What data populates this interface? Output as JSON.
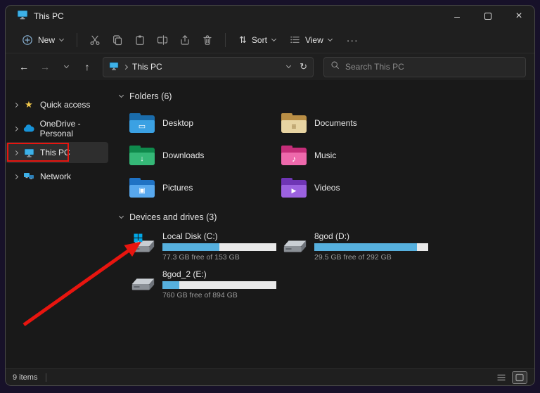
{
  "colors": {
    "annotation_red": "#e8150f",
    "drive_bar_fill": "#56b0de",
    "folder_accent_blue": "#3ba1e3"
  },
  "icons": {
    "app": "this-pc-monitor",
    "new": "circled-plus",
    "cut": "scissors",
    "copy": "two-pages",
    "paste": "clipboard",
    "rename": "text-cursor-box",
    "share": "box-up-arrow",
    "delete": "trash-can",
    "sort": "up-down-arrows",
    "view": "list-lines",
    "more": "ellipsis",
    "back": "left-arrow",
    "forward": "right-arrow",
    "recent-locations": "chevron-down",
    "up": "up-arrow",
    "refresh": "circular-arrow",
    "search": "magnifier",
    "details-view": "list-lines",
    "thumbnail-view": "square-outline"
  },
  "window": {
    "title": "This PC"
  },
  "toolbar": {
    "new_label": "New",
    "sort_label": "Sort",
    "view_label": "View",
    "more_label": "···"
  },
  "navbar": {
    "breadcrumb": "This PC",
    "search_placeholder": "Search This PC"
  },
  "sidebar": {
    "items": [
      {
        "label": "Quick access"
      },
      {
        "label": "OneDrive - Personal"
      },
      {
        "label": "This PC"
      },
      {
        "label": "Network"
      }
    ]
  },
  "main": {
    "folders_section": {
      "title": "Folders (6)"
    },
    "folders": [
      {
        "name": "Desktop"
      },
      {
        "name": "Documents"
      },
      {
        "name": "Downloads"
      },
      {
        "name": "Music"
      },
      {
        "name": "Pictures"
      },
      {
        "name": "Videos"
      }
    ],
    "drives_section": {
      "title": "Devices and drives (3)"
    },
    "drives": [
      {
        "name": "Local Disk (C:)",
        "free_text": "77.3 GB free of 153 GB",
        "used_percent": 50
      },
      {
        "name": "8god (D:)",
        "free_text": "29.5 GB free of 292 GB",
        "used_percent": 90
      },
      {
        "name": "8god_2 (E:)",
        "free_text": "760 GB free of 894 GB",
        "used_percent": 15
      }
    ]
  },
  "statusbar": {
    "items_count": "9 items"
  }
}
